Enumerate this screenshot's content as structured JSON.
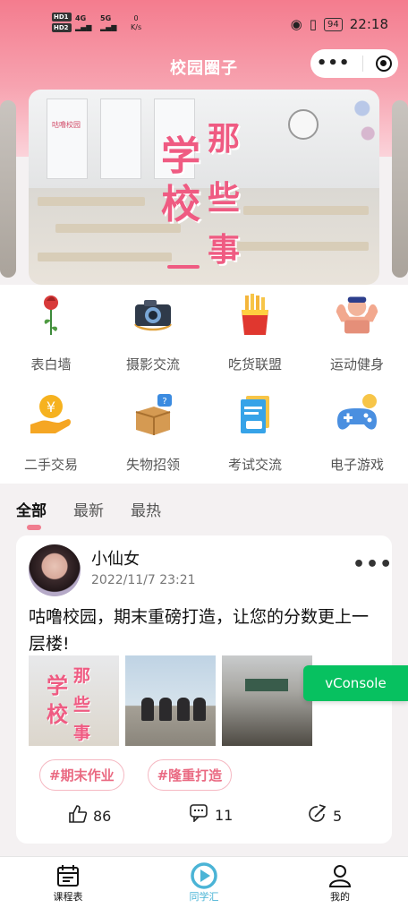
{
  "status_bar": {
    "hd1": "HD1",
    "hd2": "HD2",
    "sig1": "4G",
    "sig2": "5G",
    "speed_value": "0",
    "speed_unit": "K/s",
    "battery": "94",
    "time": "22:18"
  },
  "header": {
    "title": "校园圈子",
    "more_dots": "•••"
  },
  "banner": {
    "tag": "咕噜校园",
    "chars": [
      "学",
      "校",
      "那",
      "些",
      "事"
    ]
  },
  "categories": [
    {
      "label": "表白墙",
      "icon": "rose-icon"
    },
    {
      "label": "摄影交流",
      "icon": "camera-icon"
    },
    {
      "label": "吃货联盟",
      "icon": "fries-icon"
    },
    {
      "label": "运动健身",
      "icon": "muscle-icon"
    },
    {
      "label": "二手交易",
      "icon": "coin-hand-icon"
    },
    {
      "label": "失物招领",
      "icon": "lost-box-icon"
    },
    {
      "label": "考试交流",
      "icon": "notebook-icon"
    },
    {
      "label": "电子游戏",
      "icon": "gamepad-icon"
    }
  ],
  "feed_tabs": [
    "全部",
    "最新",
    "最热"
  ],
  "post": {
    "username": "小仙女",
    "time": "2022/11/7 23:21",
    "more": "•••",
    "content": "咕噜校园，期末重磅打造，让您的分数更上一层楼!",
    "hashtags": [
      "#期末作业",
      "#隆重打造"
    ],
    "likes": "86",
    "comments": "11",
    "shares": "5"
  },
  "vconsole": "vConsole",
  "tabbar": [
    {
      "label": "课程表",
      "icon": "schedule-icon"
    },
    {
      "label": "同学汇",
      "icon": "play-circle-icon"
    },
    {
      "label": "我的",
      "icon": "user-icon"
    }
  ],
  "colors": {
    "accent": "#f07d8f",
    "tab_active": "#4bb4d6",
    "vconsole": "#07c160"
  }
}
